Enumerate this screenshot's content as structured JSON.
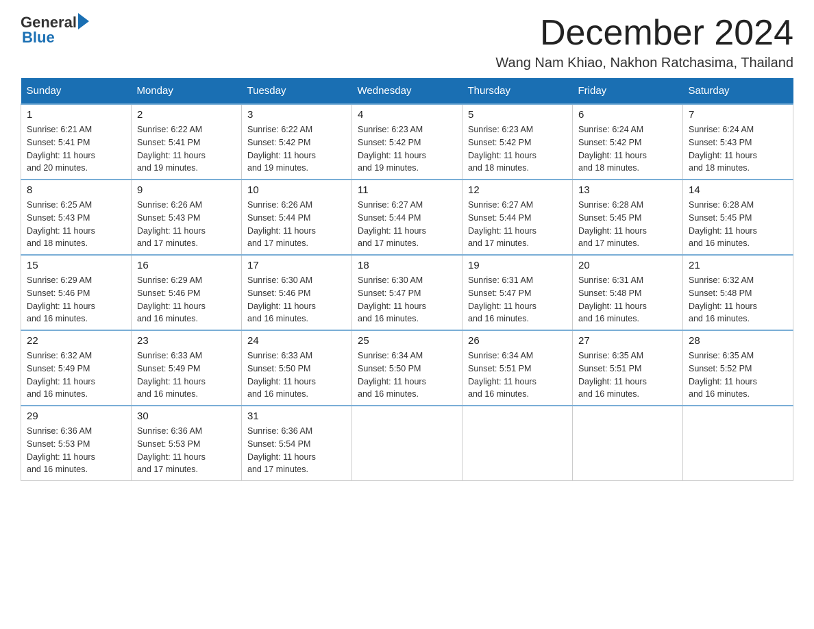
{
  "logo": {
    "text_general": "General",
    "text_blue": "Blue"
  },
  "header": {
    "month_year": "December 2024",
    "location": "Wang Nam Khiao, Nakhon Ratchasima, Thailand"
  },
  "days_of_week": [
    "Sunday",
    "Monday",
    "Tuesday",
    "Wednesday",
    "Thursday",
    "Friday",
    "Saturday"
  ],
  "weeks": [
    [
      {
        "day": "1",
        "sunrise": "6:21 AM",
        "sunset": "5:41 PM",
        "daylight": "11 hours and 20 minutes."
      },
      {
        "day": "2",
        "sunrise": "6:22 AM",
        "sunset": "5:41 PM",
        "daylight": "11 hours and 19 minutes."
      },
      {
        "day": "3",
        "sunrise": "6:22 AM",
        "sunset": "5:42 PM",
        "daylight": "11 hours and 19 minutes."
      },
      {
        "day": "4",
        "sunrise": "6:23 AM",
        "sunset": "5:42 PM",
        "daylight": "11 hours and 19 minutes."
      },
      {
        "day": "5",
        "sunrise": "6:23 AM",
        "sunset": "5:42 PM",
        "daylight": "11 hours and 18 minutes."
      },
      {
        "day": "6",
        "sunrise": "6:24 AM",
        "sunset": "5:42 PM",
        "daylight": "11 hours and 18 minutes."
      },
      {
        "day": "7",
        "sunrise": "6:24 AM",
        "sunset": "5:43 PM",
        "daylight": "11 hours and 18 minutes."
      }
    ],
    [
      {
        "day": "8",
        "sunrise": "6:25 AM",
        "sunset": "5:43 PM",
        "daylight": "11 hours and 18 minutes."
      },
      {
        "day": "9",
        "sunrise": "6:26 AM",
        "sunset": "5:43 PM",
        "daylight": "11 hours and 17 minutes."
      },
      {
        "day": "10",
        "sunrise": "6:26 AM",
        "sunset": "5:44 PM",
        "daylight": "11 hours and 17 minutes."
      },
      {
        "day": "11",
        "sunrise": "6:27 AM",
        "sunset": "5:44 PM",
        "daylight": "11 hours and 17 minutes."
      },
      {
        "day": "12",
        "sunrise": "6:27 AM",
        "sunset": "5:44 PM",
        "daylight": "11 hours and 17 minutes."
      },
      {
        "day": "13",
        "sunrise": "6:28 AM",
        "sunset": "5:45 PM",
        "daylight": "11 hours and 17 minutes."
      },
      {
        "day": "14",
        "sunrise": "6:28 AM",
        "sunset": "5:45 PM",
        "daylight": "11 hours and 16 minutes."
      }
    ],
    [
      {
        "day": "15",
        "sunrise": "6:29 AM",
        "sunset": "5:46 PM",
        "daylight": "11 hours and 16 minutes."
      },
      {
        "day": "16",
        "sunrise": "6:29 AM",
        "sunset": "5:46 PM",
        "daylight": "11 hours and 16 minutes."
      },
      {
        "day": "17",
        "sunrise": "6:30 AM",
        "sunset": "5:46 PM",
        "daylight": "11 hours and 16 minutes."
      },
      {
        "day": "18",
        "sunrise": "6:30 AM",
        "sunset": "5:47 PM",
        "daylight": "11 hours and 16 minutes."
      },
      {
        "day": "19",
        "sunrise": "6:31 AM",
        "sunset": "5:47 PM",
        "daylight": "11 hours and 16 minutes."
      },
      {
        "day": "20",
        "sunrise": "6:31 AM",
        "sunset": "5:48 PM",
        "daylight": "11 hours and 16 minutes."
      },
      {
        "day": "21",
        "sunrise": "6:32 AM",
        "sunset": "5:48 PM",
        "daylight": "11 hours and 16 minutes."
      }
    ],
    [
      {
        "day": "22",
        "sunrise": "6:32 AM",
        "sunset": "5:49 PM",
        "daylight": "11 hours and 16 minutes."
      },
      {
        "day": "23",
        "sunrise": "6:33 AM",
        "sunset": "5:49 PM",
        "daylight": "11 hours and 16 minutes."
      },
      {
        "day": "24",
        "sunrise": "6:33 AM",
        "sunset": "5:50 PM",
        "daylight": "11 hours and 16 minutes."
      },
      {
        "day": "25",
        "sunrise": "6:34 AM",
        "sunset": "5:50 PM",
        "daylight": "11 hours and 16 minutes."
      },
      {
        "day": "26",
        "sunrise": "6:34 AM",
        "sunset": "5:51 PM",
        "daylight": "11 hours and 16 minutes."
      },
      {
        "day": "27",
        "sunrise": "6:35 AM",
        "sunset": "5:51 PM",
        "daylight": "11 hours and 16 minutes."
      },
      {
        "day": "28",
        "sunrise": "6:35 AM",
        "sunset": "5:52 PM",
        "daylight": "11 hours and 16 minutes."
      }
    ],
    [
      {
        "day": "29",
        "sunrise": "6:36 AM",
        "sunset": "5:53 PM",
        "daylight": "11 hours and 16 minutes."
      },
      {
        "day": "30",
        "sunrise": "6:36 AM",
        "sunset": "5:53 PM",
        "daylight": "11 hours and 17 minutes."
      },
      {
        "day": "31",
        "sunrise": "6:36 AM",
        "sunset": "5:54 PM",
        "daylight": "11 hours and 17 minutes."
      },
      null,
      null,
      null,
      null
    ]
  ],
  "labels": {
    "sunrise": "Sunrise: ",
    "sunset": "Sunset: ",
    "daylight": "Daylight: "
  },
  "colors": {
    "header_bg": "#1a6fb3",
    "header_text": "#ffffff",
    "border_top_row": "#7aaed6"
  }
}
